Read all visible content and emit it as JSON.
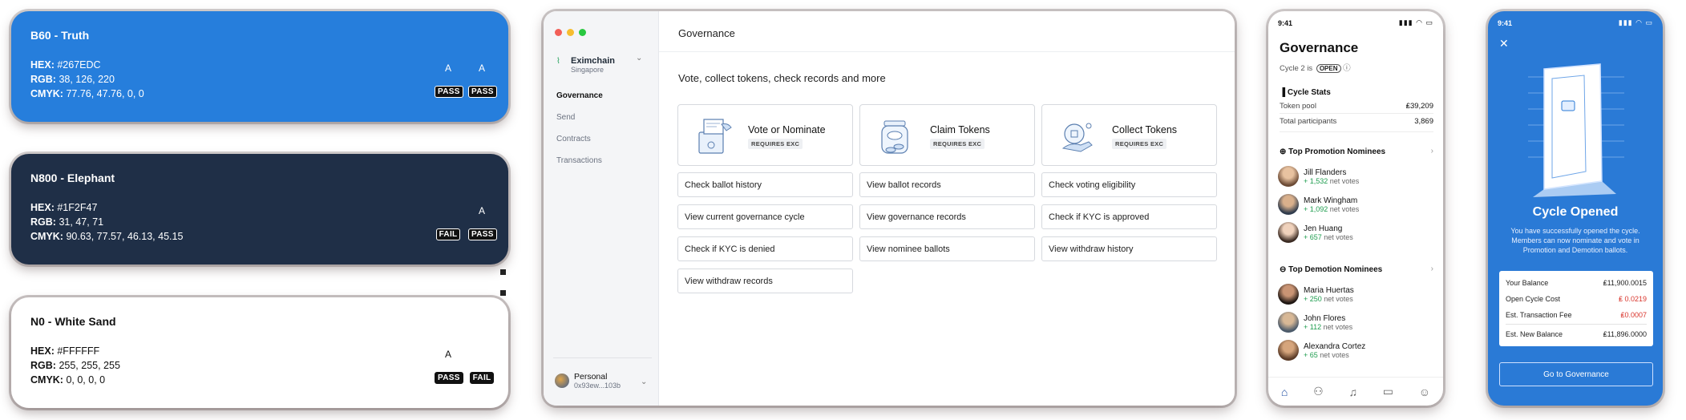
{
  "swatches": [
    {
      "title": "B60 - Truth",
      "hex_label": "HEX:",
      "hex": "#267EDC",
      "rgb_label": "RGB:",
      "rgb": "38, 126, 220",
      "cmyk_label": "CMYK:",
      "cmyk": "77.76, 47.76, 0, 0",
      "tests": [
        {
          "a": "A",
          "badge": "PASS"
        },
        {
          "a": "A",
          "badge": "PASS"
        }
      ]
    },
    {
      "title": "N800 - Elephant",
      "hex_label": "HEX:",
      "hex": "#1F2F47",
      "rgb_label": "RGB:",
      "rgb": "31, 47, 71",
      "cmyk_label": "CMYK:",
      "cmyk": "90.63, 77.57, 46.13, 45.15",
      "tests": [
        {
          "a": "",
          "badge": "FAIL"
        },
        {
          "a": "A",
          "badge": "PASS"
        }
      ]
    },
    {
      "title": "N0 - White Sand",
      "hex_label": "HEX:",
      "hex": "#FFFFFF",
      "rgb_label": "RGB:",
      "rgb": "255, 255, 255",
      "cmyk_label": "CMYK:",
      "cmyk": "0, 0, 0, 0",
      "tests": [
        {
          "a": "A",
          "badge": "PASS"
        },
        {
          "a": "",
          "badge": "FAIL"
        }
      ]
    }
  ],
  "desktop": {
    "account": {
      "name": "Eximchain",
      "region": "Singapore"
    },
    "nav": [
      "Governance",
      "Send",
      "Contracts",
      "Transactions"
    ],
    "footer": {
      "name": "Personal",
      "address": "0x93ew...103b"
    },
    "title": "Governance",
    "subtitle": "Vote, collect tokens, check records and more",
    "big_actions": [
      {
        "label": "Vote or Nominate",
        "badge": "REQUIRES EXC"
      },
      {
        "label": "Claim Tokens",
        "badge": "REQUIRES EXC"
      },
      {
        "label": "Collect Tokens",
        "badge": "REQUIRES EXC"
      }
    ],
    "links": [
      "Check ballot history",
      "View ballot records",
      "Check voting eligibility",
      "View current governance cycle",
      "View governance records",
      "Check if KYC is approved",
      "Check if KYC is denied",
      "View nominee ballots",
      "View withdraw history",
      "View withdraw records"
    ]
  },
  "phone1": {
    "time": "9:41",
    "status_icons": "▮▮▮ ◠ ▭",
    "title": "Governance",
    "cycle_prefix": "Cycle 2 is",
    "cycle_state": "OPEN",
    "stats_title": "Cycle Stats",
    "stats": [
      {
        "label": "Token pool",
        "value": "₤39,209"
      },
      {
        "label": "Total participants",
        "value": "3,869"
      }
    ],
    "promo_title": "Top Promotion Nominees",
    "promo": [
      {
        "name": "Jill Flanders",
        "plus": "+ 1,532",
        "suffix": " net votes"
      },
      {
        "name": "Mark Wingham",
        "plus": "+ 1,092",
        "suffix": " net votes"
      },
      {
        "name": "Jen Huang",
        "plus": "+ 657",
        "suffix": " net votes"
      }
    ],
    "demo_title": "Top Demotion Nominees",
    "demo": [
      {
        "name": "Maria Huertas",
        "plus": "+ 250",
        "suffix": " net votes"
      },
      {
        "name": "John Flores",
        "plus": "+ 112",
        "suffix": " net votes"
      },
      {
        "name": "Alexandra Cortez",
        "plus": "+ 65",
        "suffix": " net votes"
      }
    ]
  },
  "phone2": {
    "time": "9:41",
    "status_icons": "▮▮▮ ◠ ▭",
    "title": "Cycle Opened",
    "description": "You have successfully opened the cycle. Members can now nominate and vote in Promotion and Demotion ballots.",
    "rows": [
      {
        "label": "Your Balance",
        "value": "₤11,900.0015"
      },
      {
        "label": "Open Cycle Cost",
        "value": "₤ 0.0219"
      },
      {
        "label": "Est. Transaction Fee",
        "value": "₤0.0007"
      },
      {
        "label": "Est. New Balance",
        "value": "₤11,896.0000"
      }
    ],
    "button": "Go to Governance"
  },
  "colors": {
    "truth": "#267EDC",
    "elephant": "#1F2F47",
    "white_sand": "#FFFFFF",
    "phone_blue": "#2a7ad6",
    "positive": "#1f9d4f",
    "negative": "#d9342b"
  }
}
